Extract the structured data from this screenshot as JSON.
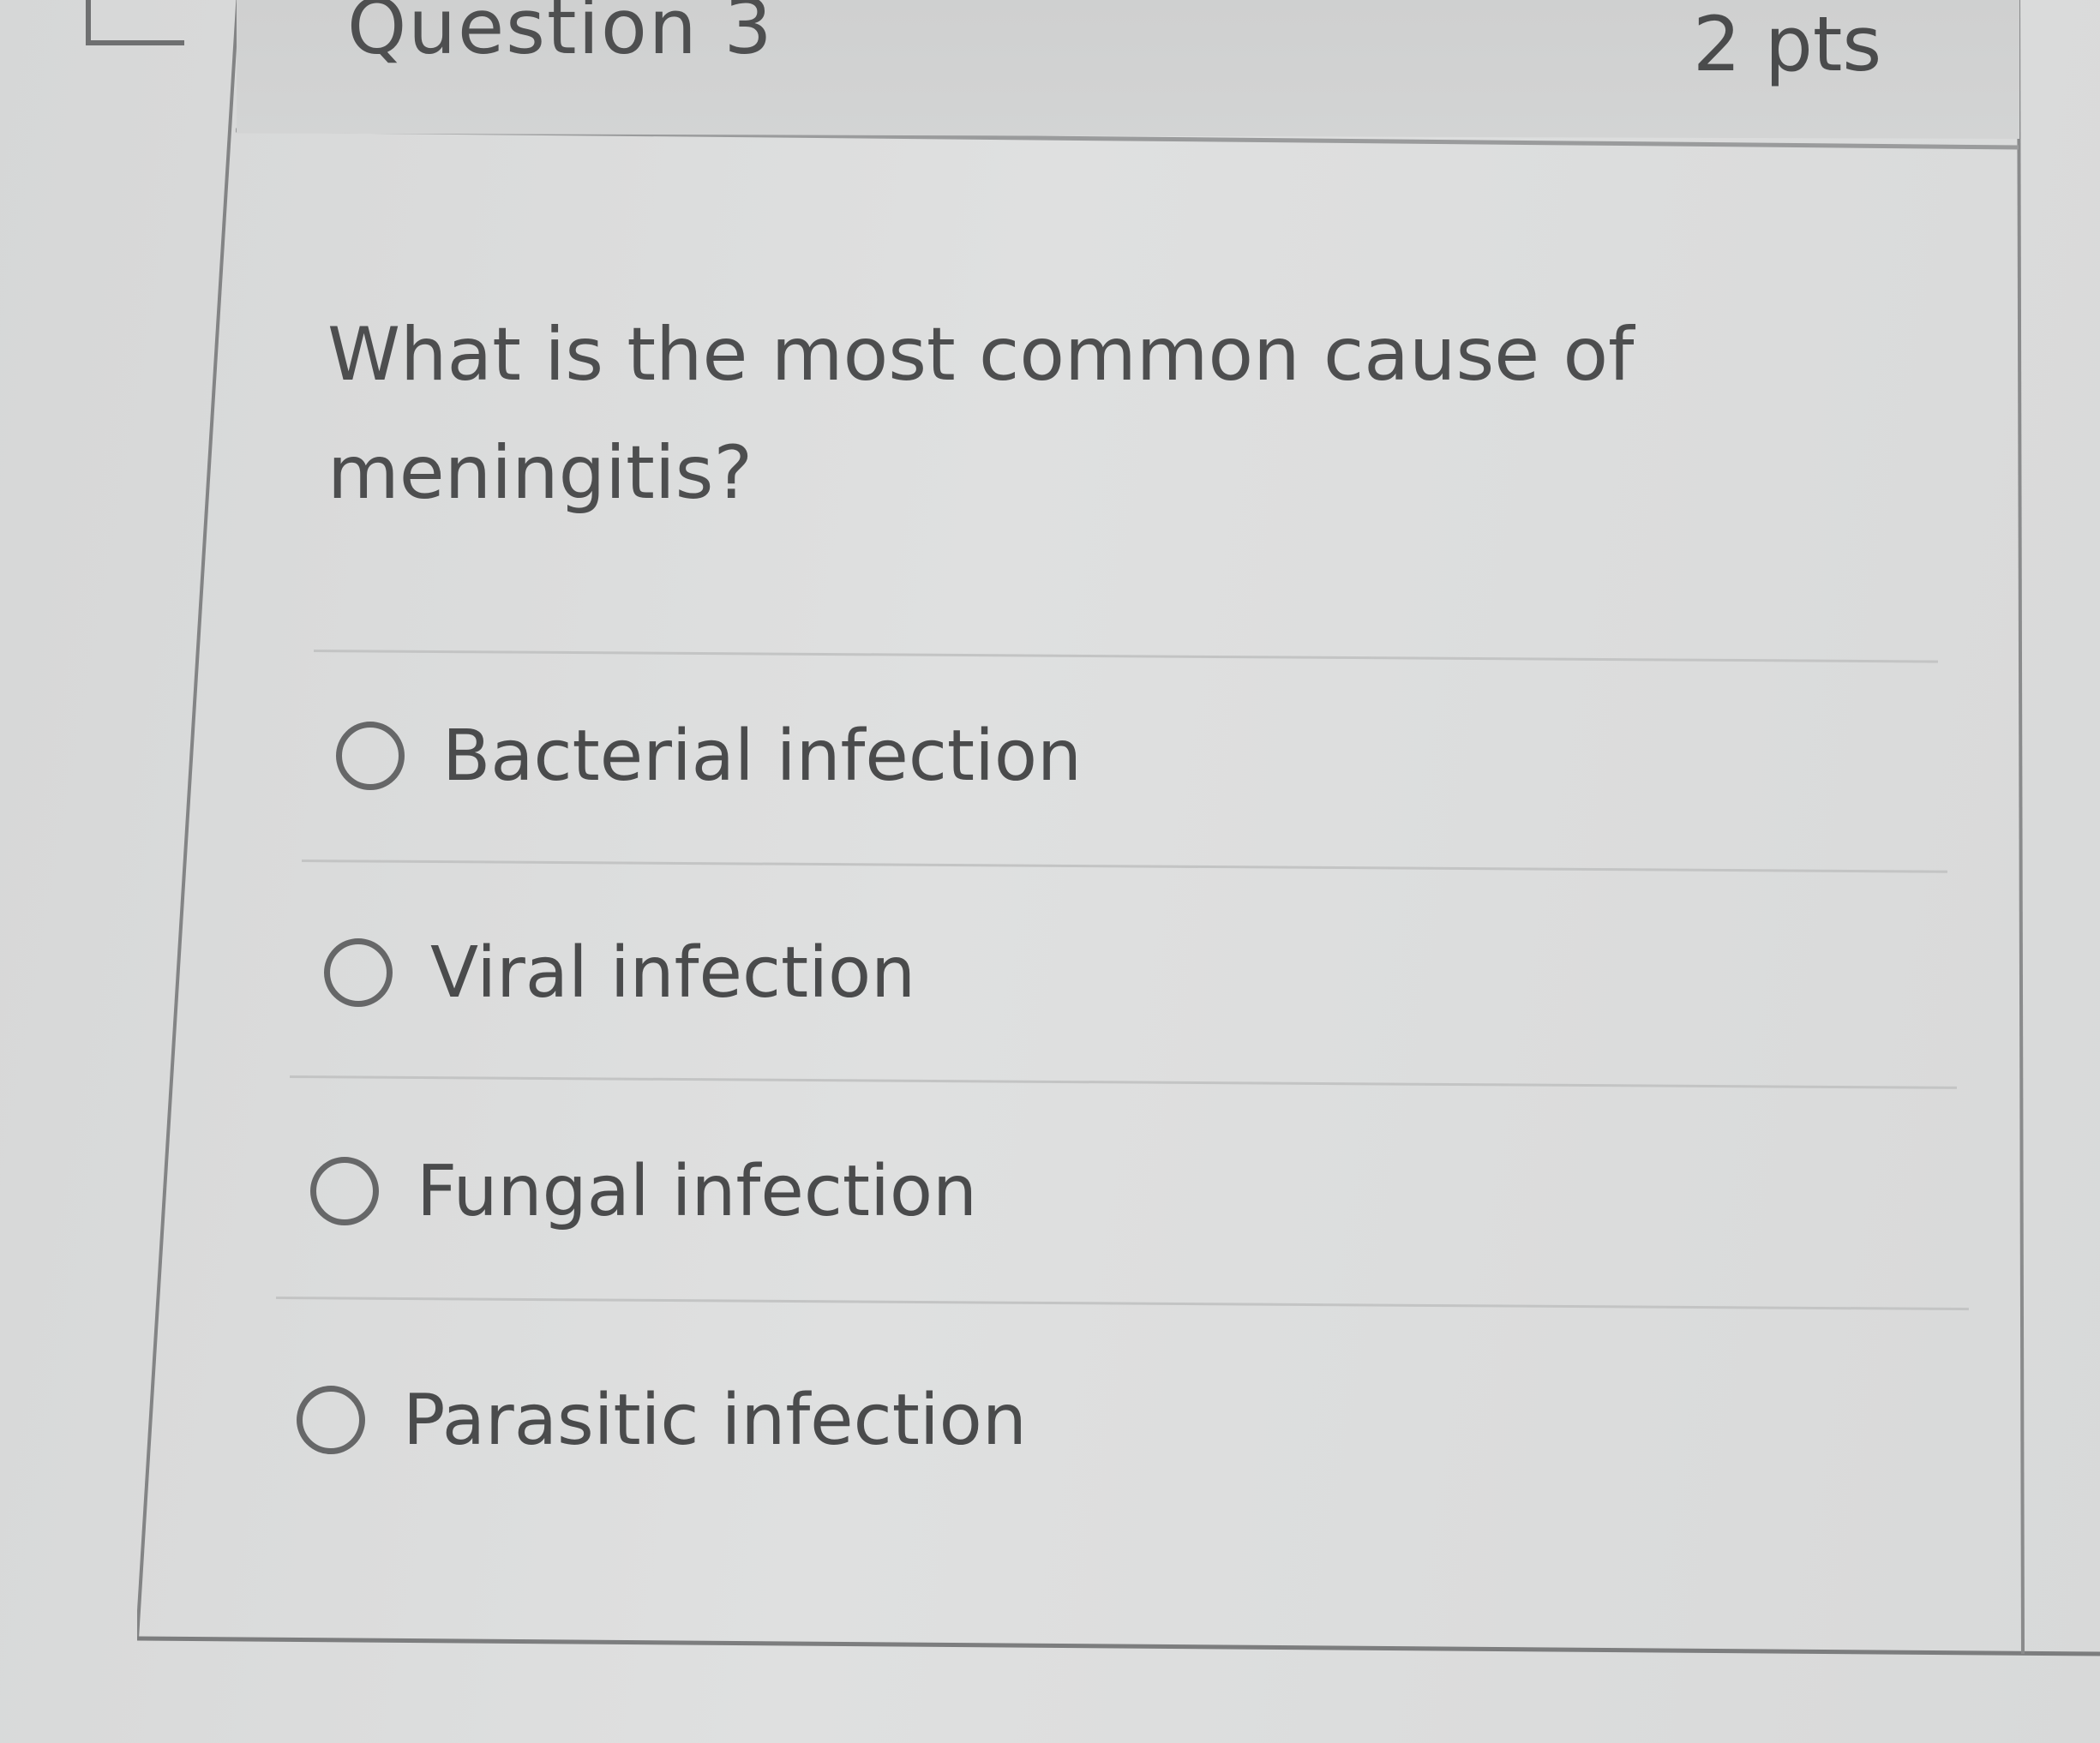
{
  "question": {
    "title": "Question 3",
    "points": "2 pts",
    "text": "What is the most common cause of meningitis?"
  },
  "answers": [
    {
      "label": "Bacterial infection",
      "selected": false
    },
    {
      "label": "Viral infection",
      "selected": false
    },
    {
      "label": "Fungal infection",
      "selected": false
    },
    {
      "label": "Parasitic infection",
      "selected": false
    }
  ],
  "icons": {
    "flag": "flag-icon",
    "radio": "radio-button-icon"
  },
  "colors": {
    "background": "#d9dada",
    "header": "#cfd0d0",
    "text": "#4d4e4f",
    "border": "#7a7b7c"
  }
}
